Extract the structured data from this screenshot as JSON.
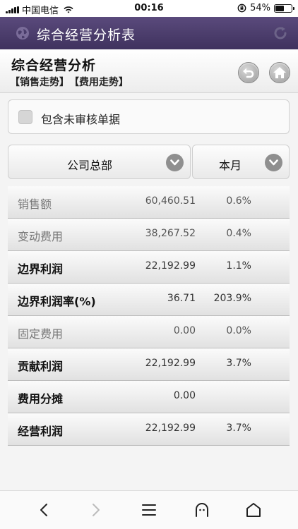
{
  "status_bar": {
    "carrier": "中国电信",
    "time": "00:16",
    "battery_percent_text": "54%",
    "battery_level": 0.54
  },
  "navbar": {
    "title": "综合经营分析表"
  },
  "header": {
    "title": "综合经营分析",
    "links": [
      "【销售走势】",
      "【费用走势】"
    ]
  },
  "filters": {
    "include_unapproved_label": "包含未审核单据",
    "include_unapproved_checked": false,
    "company_selected": "公司总部",
    "period_selected": "本月"
  },
  "rows": [
    {
      "label": "销售额",
      "amount": "60,460.51",
      "percent": "0.6%",
      "style": "muted"
    },
    {
      "label": "变动费用",
      "amount": "38,267.52",
      "percent": "0.4%",
      "style": "muted"
    },
    {
      "label": "边界利润",
      "amount": "22,192.99",
      "percent": "1.1%",
      "style": "bold"
    },
    {
      "label": "边界利润率(%)",
      "amount": "36.71",
      "percent": "203.9%",
      "style": "bold"
    },
    {
      "label": "固定费用",
      "amount": "0.00",
      "percent": "0.0%",
      "style": "muted"
    },
    {
      "label": "贡献利润",
      "amount": "22,192.99",
      "percent": "3.7%",
      "style": "bold"
    },
    {
      "label": "费用分摊",
      "amount": "0.00",
      "percent": "",
      "style": "bold"
    },
    {
      "label": "经营利润",
      "amount": "22,192.99",
      "percent": "3.7%",
      "style": "bold"
    }
  ],
  "icons": {
    "nav_left": "globe-icon",
    "nav_right": "refresh-icon",
    "header_back": "undo-icon",
    "header_home": "home-icon",
    "bottom": [
      "back-arrow-icon",
      "forward-arrow-icon",
      "menu-icon",
      "ghost-tab-icon",
      "home-outline-icon"
    ]
  },
  "colors": {
    "navbar": "#4a3d6b",
    "bottom_bar": "#fafafa"
  }
}
